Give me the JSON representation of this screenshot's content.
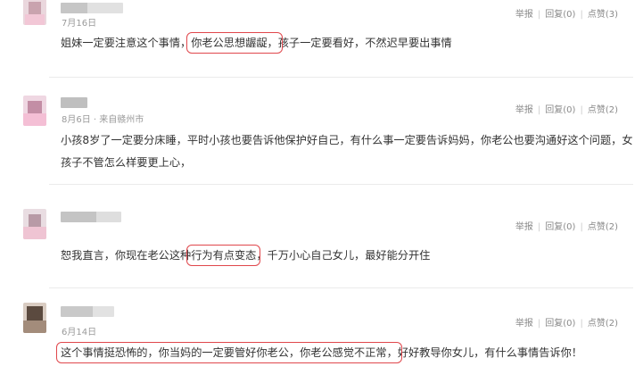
{
  "comments": [
    {
      "date": "7月16日",
      "actions": {
        "report": "举报",
        "reply": "回复(0)",
        "like": "点赞(3)"
      },
      "text_parts": [
        "姐妹一定要注意这个事情，",
        "你老公思想龌龊，",
        "孩子一定要看好，不然迟早要出事情"
      ]
    },
    {
      "date": "8月6日 · 来自赣州市",
      "actions": {
        "report": "举报",
        "reply": "回复(0)",
        "like": "点赞(2)"
      },
      "lines": [
        "小孩8岁了一定要分床睡，平时小孩也要告诉他保护好自己，有什么事一定要告诉妈妈，你老公也要沟通好这个问题，女",
        "孩子不管怎么样要更上心，"
      ]
    },
    {
      "actions": {
        "report": "举报",
        "reply": "回复(0)",
        "like": "点赞(2)"
      },
      "text_parts": [
        "恕我直言，你现在老公这种",
        "行为有点变态",
        "，千万小心自己女儿，最好能分开住"
      ]
    },
    {
      "date": "6月14日",
      "actions": {
        "report": "举报",
        "reply": "回复(0)",
        "like": "点赞(2)"
      },
      "text_parts": [
        "这个事情挺恐怖的，你当妈的一定要管好你老公，你老公感觉不正常，",
        "好好教导你女儿，有什么事情告诉你！"
      ]
    }
  ],
  "colors": {
    "highlight_box": "#e0474c",
    "text": "#333333",
    "meta": "#9a9a9a",
    "divider": "#ebebeb"
  }
}
